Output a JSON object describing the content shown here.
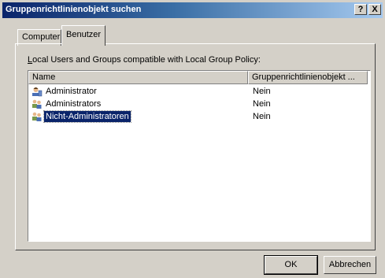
{
  "window": {
    "title": "Gruppenrichtlinienobjekt suchen",
    "help_label": "?",
    "close_label": "X"
  },
  "tabs": [
    {
      "label": "Computer",
      "active": false
    },
    {
      "label": "Benutzer",
      "active": true
    }
  ],
  "caption": {
    "accel": "L",
    "rest": "ocal Users and Groups compatible with Local Group Policy:"
  },
  "list": {
    "columns": [
      "Name",
      "Gruppenrichtlinienobjekt ..."
    ],
    "rows": [
      {
        "name": "Administrator",
        "value": "Nein",
        "icon": "user-icon",
        "selected": false
      },
      {
        "name": "Administrators",
        "value": "Nein",
        "icon": "group-icon",
        "selected": false
      },
      {
        "name": "Nicht-Administratoren",
        "value": "Nein",
        "icon": "group-icon",
        "selected": true
      }
    ]
  },
  "buttons": {
    "ok": "OK",
    "cancel": "Abbrechen"
  },
  "colors": {
    "title_start": "#0a246a",
    "title_end": "#a6caf0",
    "selection": "#0a246a",
    "face": "#d4d0c8"
  }
}
